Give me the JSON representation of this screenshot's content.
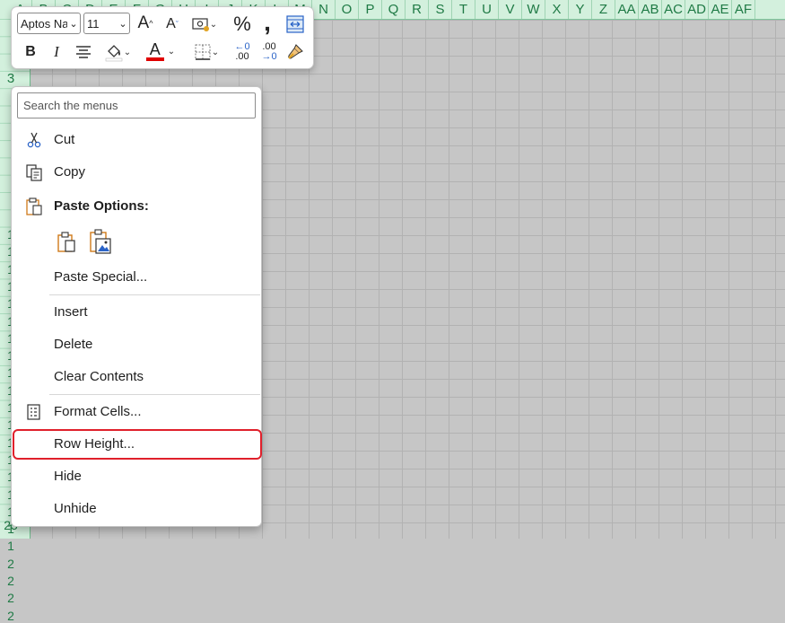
{
  "columns": [
    "A",
    "B",
    "C",
    "D",
    "E",
    "F",
    "G",
    "H",
    "I",
    "J",
    "K",
    "L",
    "M",
    "N",
    "O",
    "P",
    "Q",
    "R",
    "S",
    "T",
    "U",
    "V",
    "W",
    "X",
    "Y",
    "Z",
    "AA",
    "AB",
    "AC",
    "AD",
    "AE",
    "AF"
  ],
  "row_labels": [
    "3",
    "1",
    "1",
    "1",
    "1",
    "1",
    "1",
    "1",
    "1",
    "1",
    "1",
    "1",
    "1",
    "1",
    "1",
    "1",
    "1",
    "1",
    "1",
    "1",
    "2",
    "2",
    "2",
    "2",
    "25"
  ],
  "mini_toolbar": {
    "font_name": "Aptos Na",
    "font_size": "11",
    "percent_label": "%",
    "comma_label": ",",
    "bold_label": "B",
    "italic_label": "I",
    "font_color_label": "A",
    "increase_font_label": "A",
    "decrease_font_label": "A",
    "inc_decimal_label": ".00",
    "dec_decimal_label": ".00"
  },
  "context_menu": {
    "search_placeholder": "Search the menus",
    "cut": "Cut",
    "copy": "Copy",
    "paste_options": "Paste Options:",
    "paste_special": "Paste Special...",
    "insert": "Insert",
    "delete": "Delete",
    "clear_contents": "Clear Contents",
    "format_cells": "Format Cells...",
    "row_height": "Row Height...",
    "hide": "Hide",
    "unhide": "Unhide"
  },
  "colors": {
    "header_bg": "#d3f0dd",
    "header_text": "#1f7a45",
    "highlight_border": "#e0202b",
    "font_color_bar": "#e00000",
    "paste_icon_orange": "#d07a1a"
  }
}
